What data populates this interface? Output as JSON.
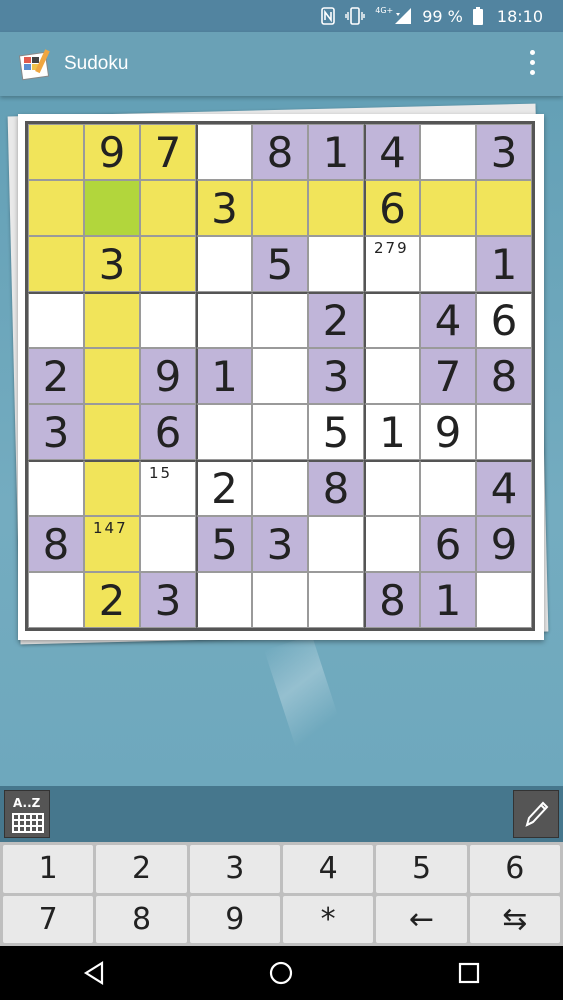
{
  "status": {
    "network": "4G+",
    "battery": "99 %",
    "time": "18:10"
  },
  "app": {
    "title": "Sudoku"
  },
  "colors": {
    "yellow": "#f1e45a",
    "green": "#b2d63c",
    "purple": "#c0b5d9",
    "white": "#ffffff"
  },
  "board": {
    "cells": [
      [
        "",
        "9",
        "7",
        "",
        "8",
        "1",
        "4",
        "",
        "3"
      ],
      [
        "",
        "",
        "",
        "3",
        "",
        "",
        "6",
        "",
        ""
      ],
      [
        "",
        "3",
        "",
        "",
        "5",
        "",
        "279",
        "",
        "1"
      ],
      [
        "",
        "",
        "",
        "",
        "",
        "2",
        "",
        "4",
        "6"
      ],
      [
        "2",
        "",
        "9",
        "1",
        "",
        "3",
        "",
        "7",
        "8"
      ],
      [
        "3",
        "",
        "6",
        "",
        "",
        "5",
        "1",
        "9",
        ""
      ],
      [
        "",
        "",
        "15",
        "2",
        "",
        "8",
        "",
        "",
        "4"
      ],
      [
        "8",
        "147",
        "",
        "5",
        "3",
        "",
        "",
        "6",
        "9"
      ],
      [
        "",
        "2",
        "3",
        "",
        "",
        "",
        "8",
        "1",
        ""
      ]
    ],
    "shades": [
      [
        "y",
        "y",
        "y",
        "w",
        "p",
        "p",
        "p",
        "w",
        "p"
      ],
      [
        "y",
        "g",
        "y",
        "y",
        "y",
        "y",
        "y",
        "y",
        "y"
      ],
      [
        "y",
        "y",
        "y",
        "w",
        "p",
        "w",
        "w",
        "w",
        "p"
      ],
      [
        "w",
        "y",
        "w",
        "w",
        "w",
        "p",
        "w",
        "p",
        "w"
      ],
      [
        "p",
        "y",
        "p",
        "p",
        "w",
        "p",
        "w",
        "p",
        "p"
      ],
      [
        "p",
        "y",
        "p",
        "w",
        "w",
        "w",
        "w",
        "w",
        "w"
      ],
      [
        "w",
        "y",
        "w",
        "w",
        "w",
        "p",
        "w",
        "w",
        "p"
      ],
      [
        "p",
        "y",
        "w",
        "p",
        "p",
        "w",
        "w",
        "p",
        "p"
      ],
      [
        "w",
        "y",
        "p",
        "w",
        "w",
        "w",
        "p",
        "p",
        "w"
      ]
    ],
    "notes": [
      [
        2,
        6
      ],
      [
        6,
        2
      ],
      [
        7,
        1
      ]
    ]
  },
  "toolbar": {
    "az_label": "A..Z"
  },
  "keypad": [
    "1",
    "2",
    "3",
    "4",
    "5",
    "6",
    "7",
    "8",
    "9",
    "*",
    "←",
    "⇆"
  ]
}
